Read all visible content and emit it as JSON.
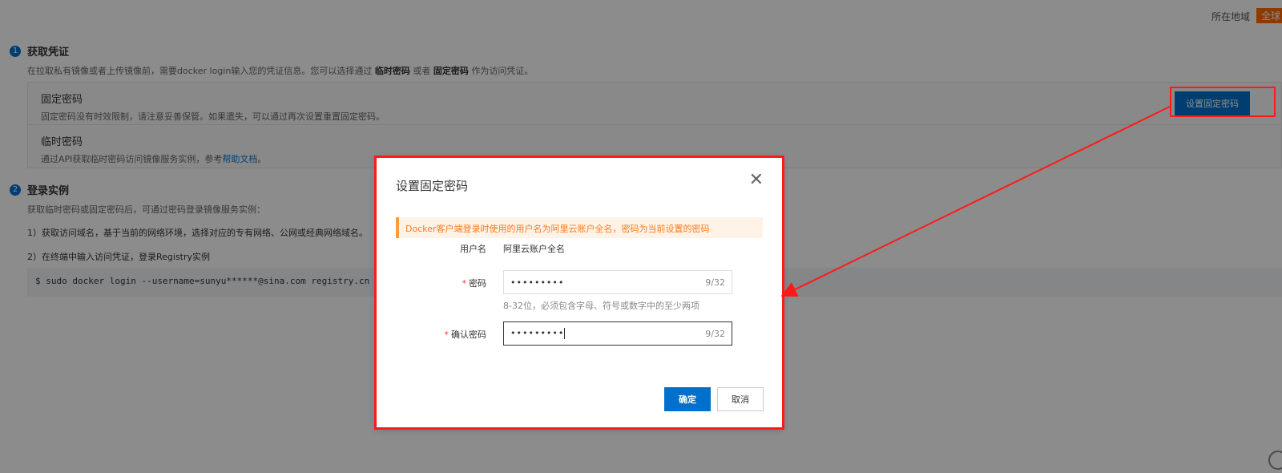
{
  "header": {
    "region_label": "所在地域",
    "region_value": "全球"
  },
  "step1": {
    "number": "1",
    "title": "获取凭证",
    "desc_prefix": "在拉取私有镜像或者上传镜像前，需要docker login输入您的凭证信息。您可以选择通过",
    "desc_temp": "临时密码",
    "desc_or": "或者",
    "desc_fixed": "固定密码",
    "desc_suffix": "作为访问凭证。",
    "fixed": {
      "title": "固定密码",
      "sub": "固定密码没有时效限制，请注意妥善保管。如果遗失，可以通过再次设置重置固定密码。",
      "button": "设置固定密码"
    },
    "temp": {
      "title": "临时密码",
      "sub_prefix": "通过API获取临时密码访问镜像服务实例，参考",
      "link": "帮助文档",
      "sub_suffix": "。"
    }
  },
  "step2": {
    "number": "2",
    "title": "登录实例",
    "desc": "获取临时密码或固定密码后，可通过密码登录镜像服务实例：",
    "line1": "1）获取访问域名，基于当前的网络环境，选择对应的专有网络、公网或经典网络域名。",
    "line2": "2）在终端中输入访问凭证，登录Registry实例",
    "code": "$ sudo docker login --username=sunyu******@sina.com registry.cn"
  },
  "modal": {
    "title": "设置固定密码",
    "close": "✕",
    "notice": "Docker客户端登录时使用的用户名为阿里云账户全名，密码为当前设置的密码",
    "username_label": "用户名",
    "username_value": "阿里云账户全名",
    "password_label": "密码",
    "password_value": "•••••••••",
    "password_count": "9/32",
    "password_hint": "8-32位，必须包含字母、符号或数字中的至少两项",
    "confirm_label": "确认密码",
    "confirm_value": "•••••••••",
    "confirm_count": "9/32",
    "required_mark": "*",
    "ok": "确定",
    "cancel": "取消"
  },
  "colors": {
    "primary": "#0070cc",
    "annotation": "#ff1a1a",
    "notice_text": "#ff7a1a",
    "notice_bg": "#fff3e8"
  }
}
